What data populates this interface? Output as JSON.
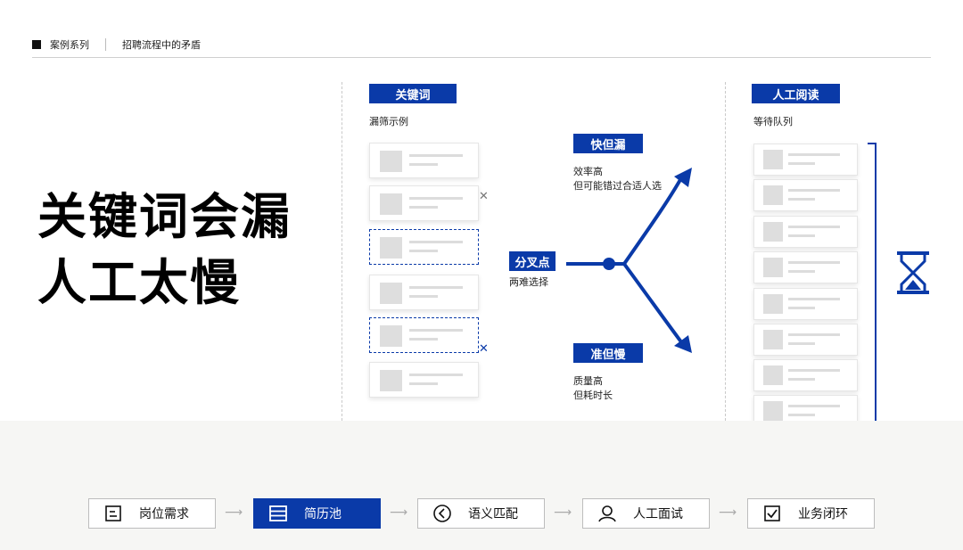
{
  "header": {
    "section": "案例系列",
    "topic": "招聘流程中的矛盾"
  },
  "headline": {
    "line1": "关键词会漏",
    "line2": "人工太慢"
  },
  "keyword": {
    "tag": "关键词",
    "subtitle": "漏筛示例"
  },
  "fork": {
    "tag": "分叉点",
    "caption": "两难选择"
  },
  "fast": {
    "tag": "快但漏",
    "line1": "效率高",
    "line2": "但可能错过合适人选"
  },
  "accurate": {
    "tag": "准但慢",
    "line1": "质量高",
    "line2": "但耗时长"
  },
  "manual": {
    "tag": "人工阅读",
    "subtitle": "等待队列"
  },
  "steps": [
    {
      "label": "岗位需求",
      "icon": "position-icon"
    },
    {
      "label": "简历池",
      "icon": "list-icon"
    },
    {
      "label": "语义匹配",
      "icon": "semantic-icon"
    },
    {
      "label": "人工面试",
      "icon": "person-icon"
    },
    {
      "label": "业务闭环",
      "icon": "check-icon"
    }
  ],
  "colors": {
    "accent": "#0a3aa8"
  }
}
